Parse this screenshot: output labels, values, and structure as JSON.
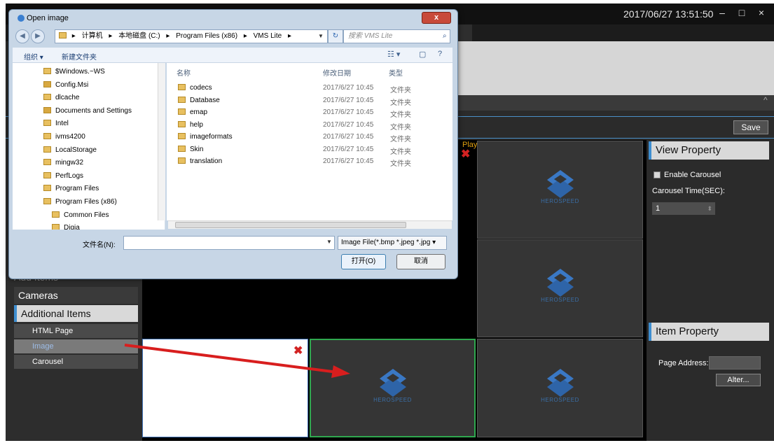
{
  "app": {
    "datetime": "2017/06/27 13:51:50",
    "minimize_icon": "–",
    "maximize_icon": "□",
    "close_icon": "×",
    "save_label": "Save",
    "collapse_icon": "^"
  },
  "left_panel": {
    "add_items_header": "Add Items",
    "sections": [
      {
        "label": "Cameras"
      },
      {
        "label": "Additional Items"
      }
    ],
    "sub_items": [
      {
        "label": "HTML Page"
      },
      {
        "label": "Image"
      },
      {
        "label": "Carousel"
      }
    ]
  },
  "grid": {
    "logo_text": "HEROSPEED",
    "close_glyph": "✖",
    "play_label": "Play"
  },
  "right_panel": {
    "view_property_title": "View Property",
    "enable_carousel_label": "Enable Carousel",
    "carousel_time_label": "Carousel Time(SEC):",
    "carousel_time_value": "1",
    "item_property_title": "Item Property",
    "page_address_label": "Page Address:",
    "alter_label": "Alter..."
  },
  "dialog": {
    "title": "Open image",
    "close_glyph": "x",
    "breadcrumb": [
      "计算机",
      "本地磁盘 (C:)",
      "Program Files (x86)",
      "VMS Lite"
    ],
    "search_placeholder": "搜索 VMS Lite",
    "toolbar": {
      "organize": "组织 ▾",
      "new_folder": "新建文件夹"
    },
    "nav_tree": [
      "$Windows.~WS",
      "Config.Msi",
      "dlcache",
      "Documents and Settings",
      "Intel",
      "ivms4200",
      "LocalStorage",
      "mingw32",
      "PerfLogs",
      "Program Files",
      "Program Files (x86)",
      "Common Files",
      "Digia"
    ],
    "columns": {
      "name": "名称",
      "date": "修改日期",
      "type": "类型"
    },
    "files": [
      {
        "name": "codecs",
        "date": "2017/6/27 10:45",
        "type": "文件夹"
      },
      {
        "name": "Database",
        "date": "2017/6/27 10:45",
        "type": "文件夹"
      },
      {
        "name": "emap",
        "date": "2017/6/27 10:45",
        "type": "文件夹"
      },
      {
        "name": "help",
        "date": "2017/6/27 10:45",
        "type": "文件夹"
      },
      {
        "name": "imageformats",
        "date": "2017/6/27 10:45",
        "type": "文件夹"
      },
      {
        "name": "Skin",
        "date": "2017/6/27 10:45",
        "type": "文件夹"
      },
      {
        "name": "translation",
        "date": "2017/6/27 10:45",
        "type": "文件夹"
      }
    ],
    "filename_label": "文件名(N):",
    "filename_value": "",
    "filter_value": "Image File(*.bmp *.jpeg *.jpg",
    "open_label": "打开(O)",
    "cancel_label": "取消"
  },
  "colors": {
    "accent_blue": "#3e8ed0",
    "selected_border_green": "#2fa84f",
    "arrow_red": "#d81e1e",
    "app_background": "#2b2b2b"
  }
}
